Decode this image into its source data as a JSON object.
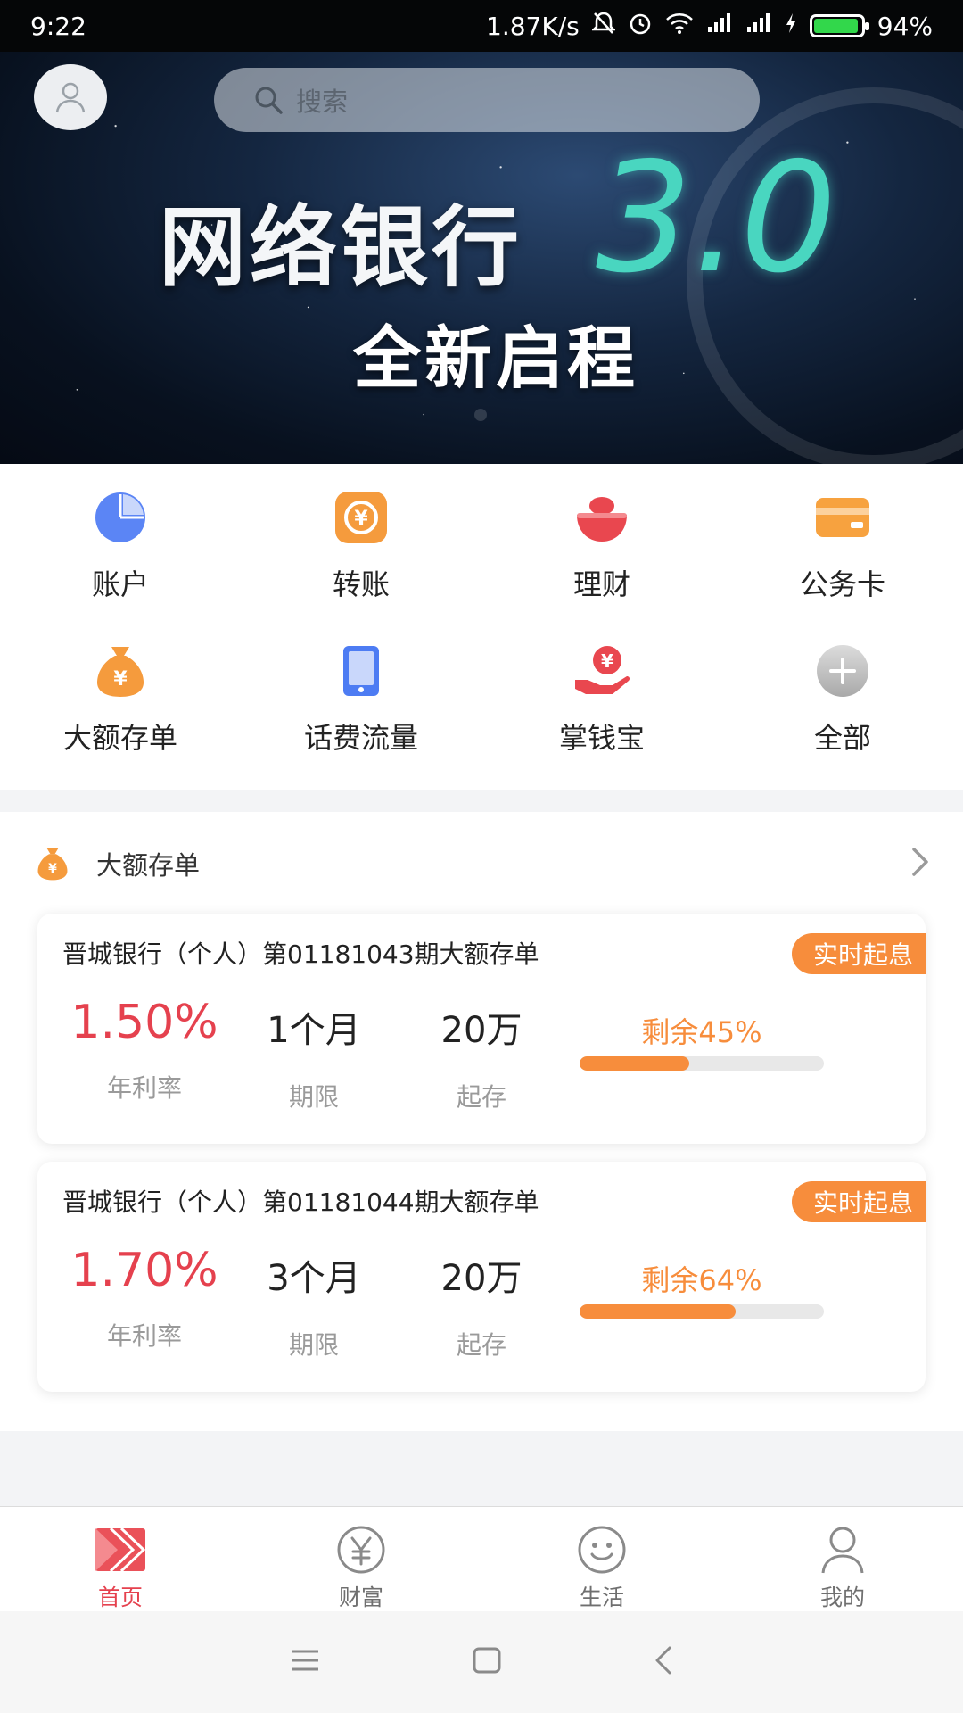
{
  "status_bar": {
    "time": "9:22",
    "net_speed": "1.87K/s",
    "battery_percent": "94%",
    "battery_level": 0.94
  },
  "header": {
    "search_placeholder": "搜索",
    "avatar_icon": "user-icon"
  },
  "banner": {
    "headline": "网络银行",
    "version": "3.0",
    "subtitle": "全新启程",
    "slide_count": 1,
    "active_slide": 1
  },
  "quick_actions": [
    {
      "label": "账户",
      "icon": "pie-chart-icon",
      "color": "#4d7cf3"
    },
    {
      "label": "转账",
      "icon": "transfer-icon",
      "color": "#f59b3d"
    },
    {
      "label": "理财",
      "icon": "gold-ingot-icon",
      "color": "#e9474f"
    },
    {
      "label": "公务卡",
      "icon": "card-icon",
      "color": "#f7a23f"
    },
    {
      "label": "大额存单",
      "icon": "money-bag-icon",
      "color": "#f59b3d"
    },
    {
      "label": "话费流量",
      "icon": "phone-icon",
      "color": "#4d7cf3"
    },
    {
      "label": "掌钱宝",
      "icon": "hand-coin-icon",
      "color": "#e9474f"
    },
    {
      "label": "全部",
      "icon": "plus-circle-icon",
      "color": "#bdbdbd"
    }
  ],
  "deposit_section": {
    "title": "大额存单",
    "icon": "money-bag-icon",
    "arrow_icon": "chevron-right-icon",
    "products": [
      {
        "title": "晋城银行（个人）第01181043期大额存单",
        "badge": "实时起息",
        "rate": "1.50%",
        "rate_label": "年利率",
        "term": "1个月",
        "term_label": "期限",
        "min_amount": "20万",
        "min_label": "起存",
        "remaining_text": "剩余45%",
        "remaining": 0.45
      },
      {
        "title": "晋城银行（个人）第01181044期大额存单",
        "badge": "实时起息",
        "rate": "1.70%",
        "rate_label": "年利率",
        "term": "3个月",
        "term_label": "期限",
        "min_amount": "20万",
        "min_label": "起存",
        "remaining_text": "剩余64%",
        "remaining": 0.64
      }
    ]
  },
  "bottom_nav": [
    {
      "label": "首页",
      "icon": "home-icon",
      "active": true
    },
    {
      "label": "财富",
      "icon": "yuan-icon",
      "active": false
    },
    {
      "label": "生活",
      "icon": "smile-icon",
      "active": false
    },
    {
      "label": "我的",
      "icon": "user-icon",
      "active": false
    }
  ],
  "system_nav": [
    "menu-icon",
    "home-square-icon",
    "back-icon"
  ],
  "colors": {
    "accent_orange": "#f78d3c",
    "rate_red": "#e5414e",
    "active_tab": "#e5414e"
  }
}
